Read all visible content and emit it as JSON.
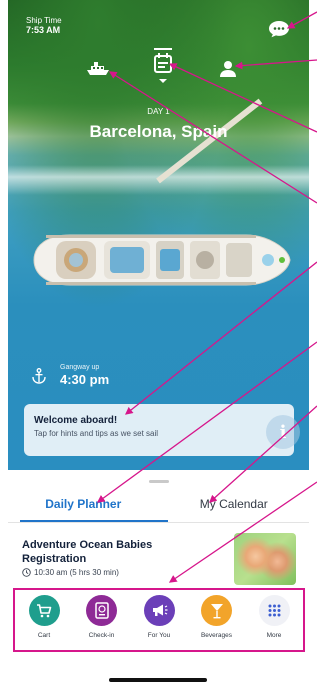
{
  "header": {
    "ship_time_label": "Ship Time",
    "ship_time_value": "7:53 AM",
    "day_label": "DAY 1",
    "port_name": "Barcelona, Spain"
  },
  "top_icons": [
    "cruise-ship-icon",
    "planner-icon",
    "profile-icon",
    "chat-icon"
  ],
  "gangway": {
    "label": "Gangway up",
    "time": "4:30 pm"
  },
  "welcome_card": {
    "title": "Welcome aboard!",
    "subtitle": "Tap for hints and tips as we set sail",
    "icon": "info-icon"
  },
  "tabs": [
    {
      "label": "Daily Planner",
      "active": true
    },
    {
      "label": "My Calendar",
      "active": false
    }
  ],
  "event": {
    "title": "Adventure Ocean Babies Registration",
    "time": "10:30 am (5 hrs 30 min)"
  },
  "bottom_nav": [
    {
      "label": "Cart",
      "icon": "cart-icon",
      "color": "#1f9e8d"
    },
    {
      "label": "Check-in",
      "icon": "passport-icon",
      "color": "#8e2a96"
    },
    {
      "label": "For You",
      "icon": "megaphone-icon",
      "color": "#6b3fb8"
    },
    {
      "label": "Beverages",
      "icon": "cocktail-icon",
      "color": "#f2a42a"
    },
    {
      "label": "More",
      "icon": "grid-icon",
      "color": "#f0f1f6"
    }
  ],
  "colors": {
    "accent": "#2074c9",
    "annotation": "#d6168b"
  }
}
